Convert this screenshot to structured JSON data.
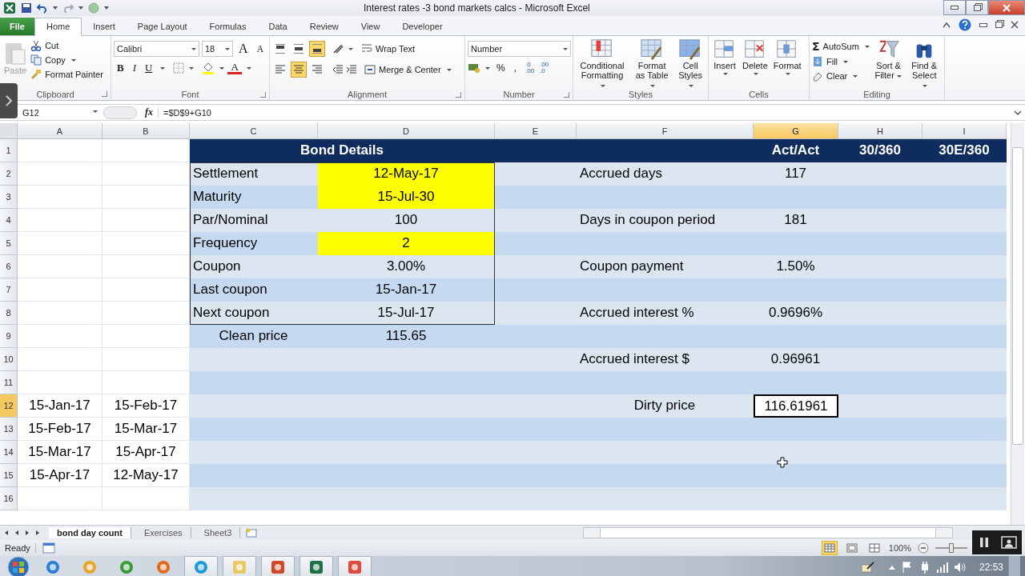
{
  "window": {
    "title": "Interest rates -3 bond markets calcs  -  Microsoft Excel"
  },
  "ribbon_tabs": [
    {
      "label": "File",
      "kind": "file",
      "selected": false
    },
    {
      "label": "Home",
      "kind": "tab",
      "selected": true
    },
    {
      "label": "Insert",
      "kind": "tab",
      "selected": false
    },
    {
      "label": "Page Layout",
      "kind": "tab",
      "selected": false
    },
    {
      "label": "Formulas",
      "kind": "tab",
      "selected": false
    },
    {
      "label": "Data",
      "kind": "tab",
      "selected": false
    },
    {
      "label": "Review",
      "kind": "tab",
      "selected": false
    },
    {
      "label": "View",
      "kind": "tab",
      "selected": false
    },
    {
      "label": "Developer",
      "kind": "tab",
      "selected": false
    }
  ],
  "ribbon": {
    "clipboard": {
      "label": "Clipboard",
      "paste": {
        "label": "Paste",
        "disabled": true
      },
      "cut": "Cut",
      "copy": "Copy",
      "format_painter": "Format Painter"
    },
    "font": {
      "label": "Font",
      "name": "Calibri",
      "size": "18",
      "grow": "A",
      "shrink": "A",
      "bold": "B",
      "italic": "I",
      "underline": "U",
      "color_letter": "A"
    },
    "alignment": {
      "label": "Alignment",
      "vertical": [
        {
          "selected": false
        },
        {
          "selected": false
        },
        {
          "selected": true
        }
      ],
      "horizontal": [
        {
          "selected": false
        },
        {
          "selected": true
        },
        {
          "selected": false
        }
      ],
      "wrap_text": "Wrap Text",
      "merge_center": "Merge & Center"
    },
    "number": {
      "label": "Number",
      "format": "Number",
      "percent": "%",
      "comma": ",",
      "increase_decimal": [
        ".0",
        ".00"
      ],
      "decrease_decimal": [
        ".00",
        ".0"
      ]
    },
    "styles": {
      "label": "Styles",
      "buttons": [
        "Conditional Formatting",
        "Format as Table",
        "Cell Styles"
      ]
    },
    "cells": {
      "label": "Cells",
      "buttons": [
        "Insert",
        "Delete",
        "Format"
      ]
    },
    "editing": {
      "label": "Editing",
      "autosum_symbol": "Σ",
      "small": [
        "AutoSum",
        "Fill",
        "Clear"
      ],
      "large": [
        "Sort & Filter",
        "Find & Select"
      ]
    }
  },
  "formula_bar": {
    "name_box": "G12",
    "fx": "fx",
    "formula": "=$D$9+G10"
  },
  "columns": [
    {
      "label": "A",
      "selected": false
    },
    {
      "label": "B",
      "selected": false
    },
    {
      "label": "C",
      "selected": false
    },
    {
      "label": "D",
      "selected": false
    },
    {
      "label": "E",
      "selected": false
    },
    {
      "label": "F",
      "selected": false
    },
    {
      "label": "G",
      "selected": true
    },
    {
      "label": "H",
      "selected": false
    },
    {
      "label": "I",
      "selected": false
    }
  ],
  "rows": [
    {
      "number": "1",
      "selected": false,
      "cells": [
        {
          "kind": "blank",
          "selected": false
        },
        {
          "kind": "blank",
          "selected": false
        },
        {
          "kind": "merged-header",
          "text": "Bond Details",
          "selected": false
        },
        {
          "kind": "header",
          "selected": false
        },
        {
          "kind": "header",
          "selected": false
        },
        {
          "kind": "header",
          "text": "Act/Act",
          "selected": false
        },
        {
          "kind": "header",
          "text": "30/360",
          "selected": false
        },
        {
          "kind": "header",
          "text": "30E/360",
          "selected": false
        }
      ]
    },
    {
      "number": "2",
      "selected": false,
      "cells": [
        {
          "kind": "blank",
          "selected": false
        },
        {
          "kind": "blank",
          "selected": false
        },
        {
          "kind": "label",
          "text": "Settlement",
          "selected": false
        },
        {
          "kind": "input",
          "text": "12-May-17",
          "selected": false
        },
        {
          "kind": "blank",
          "selected": false
        },
        {
          "kind": "label",
          "text": "Accrued days",
          "selected": false
        },
        {
          "kind": "value",
          "text": "117",
          "selected": false
        },
        {
          "kind": "blank",
          "selected": false
        },
        {
          "kind": "blank",
          "selected": false
        }
      ]
    },
    {
      "number": "3",
      "selected": false,
      "cells": [
        {
          "kind": "blank",
          "selected": false
        },
        {
          "kind": "blank",
          "selected": false
        },
        {
          "kind": "label",
          "text": "Maturity",
          "selected": false
        },
        {
          "kind": "input",
          "text": "15-Jul-30",
          "selected": false
        },
        {
          "kind": "blank",
          "selected": false
        },
        {
          "kind": "blank",
          "selected": false
        },
        {
          "kind": "blank",
          "selected": false
        },
        {
          "kind": "blank",
          "selected": false
        },
        {
          "kind": "blank",
          "selected": false
        }
      ]
    },
    {
      "number": "4",
      "selected": false,
      "cells": [
        {
          "kind": "blank",
          "selected": false
        },
        {
          "kind": "blank",
          "selected": false
        },
        {
          "kind": "label",
          "text": "Par/Nominal",
          "selected": false
        },
        {
          "kind": "value",
          "text": "100",
          "selected": false
        },
        {
          "kind": "blank",
          "selected": false
        },
        {
          "kind": "label",
          "text": "Days in coupon period",
          "selected": false
        },
        {
          "kind": "value",
          "text": "181",
          "selected": false
        },
        {
          "kind": "blank",
          "selected": false
        },
        {
          "kind": "blank",
          "selected": false
        }
      ]
    },
    {
      "number": "5",
      "selected": false,
      "cells": [
        {
          "kind": "blank",
          "selected": false
        },
        {
          "kind": "blank",
          "selected": false
        },
        {
          "kind": "label",
          "text": "Frequency",
          "selected": false
        },
        {
          "kind": "input",
          "text": "2",
          "selected": false
        },
        {
          "kind": "blank",
          "selected": false
        },
        {
          "kind": "blank",
          "selected": false
        },
        {
          "kind": "blank",
          "selected": false
        },
        {
          "kind": "blank",
          "selected": false
        },
        {
          "kind": "blank",
          "selected": false
        }
      ]
    },
    {
      "number": "6",
      "selected": false,
      "cells": [
        {
          "kind": "blank",
          "selected": false
        },
        {
          "kind": "blank",
          "selected": false
        },
        {
          "kind": "label",
          "text": "Coupon",
          "selected": false
        },
        {
          "kind": "value",
          "text": "3.00%",
          "selected": false
        },
        {
          "kind": "blank",
          "selected": false
        },
        {
          "kind": "label",
          "text": "Coupon payment",
          "selected": false
        },
        {
          "kind": "value",
          "text": "1.50%",
          "selected": false
        },
        {
          "kind": "blank",
          "selected": false
        },
        {
          "kind": "blank",
          "selected": false
        }
      ]
    },
    {
      "number": "7",
      "selected": false,
      "cells": [
        {
          "kind": "blank",
          "selected": false
        },
        {
          "kind": "blank",
          "selected": false
        },
        {
          "kind": "label",
          "text": "Last coupon",
          "selected": false
        },
        {
          "kind": "value",
          "text": "15-Jan-17",
          "selected": false
        },
        {
          "kind": "blank",
          "selected": false
        },
        {
          "kind": "blank",
          "selected": false
        },
        {
          "kind": "blank",
          "selected": false
        },
        {
          "kind": "blank",
          "selected": false
        },
        {
          "kind": "blank",
          "selected": false
        }
      ]
    },
    {
      "number": "8",
      "selected": false,
      "cells": [
        {
          "kind": "blank",
          "selected": false
        },
        {
          "kind": "blank",
          "selected": false
        },
        {
          "kind": "label",
          "text": "Next coupon",
          "selected": false
        },
        {
          "kind": "value",
          "text": "15-Jul-17",
          "selected": false
        },
        {
          "kind": "blank",
          "selected": false
        },
        {
          "kind": "label",
          "text": "Accrued interest %",
          "selected": false
        },
        {
          "kind": "value",
          "text": "0.9696%",
          "selected": false
        },
        {
          "kind": "blank",
          "selected": false
        },
        {
          "kind": "blank",
          "selected": false
        }
      ]
    },
    {
      "number": "9",
      "selected": false,
      "cells": [
        {
          "kind": "blank",
          "selected": false
        },
        {
          "kind": "blank",
          "selected": false
        },
        {
          "kind": "value",
          "text": "Clean price",
          "selected": false
        },
        {
          "kind": "value",
          "text": "115.65",
          "selected": false
        },
        {
          "kind": "blank",
          "selected": false
        },
        {
          "kind": "blank",
          "selected": false
        },
        {
          "kind": "blank",
          "selected": false
        },
        {
          "kind": "blank",
          "selected": false
        },
        {
          "kind": "blank",
          "selected": false
        }
      ]
    },
    {
      "number": "10",
      "selected": false,
      "cells": [
        {
          "kind": "blank",
          "selected": false
        },
        {
          "kind": "blank",
          "selected": false
        },
        {
          "kind": "blank",
          "selected": false
        },
        {
          "kind": "blank",
          "selected": false
        },
        {
          "kind": "blank",
          "selected": false
        },
        {
          "kind": "label",
          "text": "Accrued interest $",
          "selected": false
        },
        {
          "kind": "value",
          "text": "0.96961",
          "selected": false
        },
        {
          "kind": "blank",
          "selected": false
        },
        {
          "kind": "blank",
          "selected": false
        }
      ]
    },
    {
      "number": "11",
      "selected": false,
      "cells": [
        {
          "kind": "blank",
          "selected": false
        },
        {
          "kind": "blank",
          "selected": false
        },
        {
          "kind": "blank",
          "selected": false
        },
        {
          "kind": "blank",
          "selected": false
        },
        {
          "kind": "blank",
          "selected": false
        },
        {
          "kind": "blank",
          "selected": false
        },
        {
          "kind": "blank",
          "selected": false
        },
        {
          "kind": "blank",
          "selected": false
        },
        {
          "kind": "blank",
          "selected": false
        }
      ]
    },
    {
      "number": "12",
      "selected": true,
      "cells": [
        {
          "kind": "value",
          "text": "15-Jan-17",
          "selected": false
        },
        {
          "kind": "value",
          "text": "15-Feb-17",
          "selected": false
        },
        {
          "kind": "blank",
          "selected": false
        },
        {
          "kind": "blank",
          "selected": false
        },
        {
          "kind": "blank",
          "selected": false
        },
        {
          "kind": "value",
          "text": "Dirty price",
          "selected": false
        },
        {
          "kind": "value",
          "text": "116.61961",
          "selected": true
        },
        {
          "kind": "blank",
          "selected": false
        },
        {
          "kind": "blank",
          "selected": false
        }
      ]
    },
    {
      "number": "13",
      "selected": false,
      "cells": [
        {
          "kind": "value",
          "text": "15-Feb-17",
          "selected": false
        },
        {
          "kind": "value",
          "text": "15-Mar-17",
          "selected": false
        },
        {
          "kind": "blank",
          "selected": false
        },
        {
          "kind": "blank",
          "selected": false
        },
        {
          "kind": "blank",
          "selected": false
        },
        {
          "kind": "blank",
          "selected": false
        },
        {
          "kind": "blank",
          "selected": false
        },
        {
          "kind": "blank",
          "selected": false
        },
        {
          "kind": "blank",
          "selected": false
        }
      ]
    },
    {
      "number": "14",
      "selected": false,
      "cells": [
        {
          "kind": "value",
          "text": "15-Mar-17",
          "selected": false
        },
        {
          "kind": "value",
          "text": "15-Apr-17",
          "selected": false
        },
        {
          "kind": "blank",
          "selected": false
        },
        {
          "kind": "blank",
          "selected": false
        },
        {
          "kind": "blank",
          "selected": false
        },
        {
          "kind": "blank",
          "selected": false
        },
        {
          "kind": "blank",
          "selected": false
        },
        {
          "kind": "blank",
          "selected": false
        },
        {
          "kind": "blank",
          "selected": false
        }
      ]
    },
    {
      "number": "15",
      "selected": false,
      "cells": [
        {
          "kind": "value",
          "text": "15-Apr-17",
          "selected": false
        },
        {
          "kind": "value",
          "text": "12-May-17",
          "selected": false
        },
        {
          "kind": "blank",
          "selected": false
        },
        {
          "kind": "blank",
          "selected": false
        },
        {
          "kind": "blank",
          "selected": false
        },
        {
          "kind": "blank",
          "selected": false
        },
        {
          "kind": "blank",
          "selected": false
        },
        {
          "kind": "blank",
          "selected": false
        },
        {
          "kind": "blank",
          "selected": false
        }
      ]
    },
    {
      "number": "16",
      "selected": false,
      "cells": [
        {
          "kind": "blank",
          "selected": false
        },
        {
          "kind": "blank",
          "selected": false
        },
        {
          "kind": "blank",
          "selected": false
        },
        {
          "kind": "blank",
          "selected": false
        },
        {
          "kind": "blank",
          "selected": false
        },
        {
          "kind": "blank",
          "selected": false
        },
        {
          "kind": "blank",
          "selected": false
        },
        {
          "kind": "blank",
          "selected": false
        },
        {
          "kind": "blank",
          "selected": false
        }
      ]
    }
  ],
  "sheet_tabs": [
    {
      "label": "bond day count",
      "selected": true
    },
    {
      "label": "Exercises",
      "selected": false
    },
    {
      "label": "Sheet3",
      "selected": false
    }
  ],
  "status_bar": {
    "status": "Ready",
    "zoom": "100%",
    "zoom_slider": {
      "level": 0.5
    },
    "views": [
      {
        "selected": true
      },
      {
        "selected": false
      },
      {
        "selected": false
      }
    ]
  },
  "taskbar": {
    "clock": "22:53"
  }
}
